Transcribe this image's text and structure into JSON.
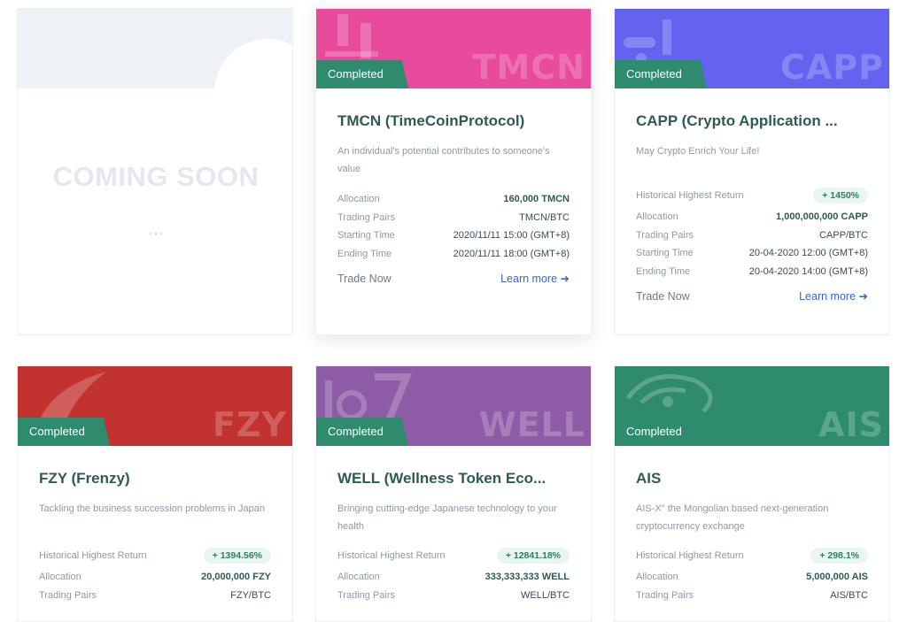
{
  "coming_soon": {
    "text": "COMING SOON",
    "dots": "..."
  },
  "common": {
    "badge": "Completed",
    "trade_label": "Trade Now",
    "learn_label": "Learn more",
    "arrow": "➜",
    "labels": {
      "historical": "Historical Highest Return",
      "allocation": "Allocation",
      "pairs": "Trading Pairs",
      "start": "Starting Time",
      "end": "Ending Time"
    }
  },
  "cards": [
    {
      "ticker": "TMCN",
      "banner_color": "#e84a9c",
      "title": "TMCN (TimeCoinProtocol)",
      "desc": "An individual's potential contributes to someone's value",
      "allocation": "160,000 TMCN",
      "pairs": "TMCN/BTC",
      "start": "2020/11/11 15:00 (GMT+8)",
      "end": "2020/11/11 18:00 (GMT+8)"
    },
    {
      "ticker": "CAPP",
      "banner_color": "#6363f0",
      "title": "CAPP  (Crypto Application ...",
      "desc": "May Crypto Enrich Your Life!",
      "historical": "+ 1450%",
      "allocation": "1,000,000,000 CAPP",
      "pairs": "CAPP/BTC",
      "start": "20-04-2020 12:00 (GMT+8)",
      "end": "20-04-2020 14:00 (GMT+8)"
    },
    {
      "ticker": "FZY",
      "banner_color": "#c2332f",
      "title": "FZY (Frenzy)",
      "desc": "Tackling the business succession problems in Japan",
      "historical": "+ 1394.56%",
      "allocation": "20,000,000 FZY",
      "pairs": "FZY/BTC"
    },
    {
      "ticker": "WELL",
      "banner_color": "#8e5ca6",
      "title": "WELL (Wellness Token Eco...",
      "desc": "Bringing cutting-edge Japanese technology to your health",
      "historical": "+ 12841.18%",
      "allocation": "333,333,333 WELL",
      "pairs": "WELL/BTC"
    },
    {
      "ticker": "AIS",
      "banner_color": "#2e8b6e",
      "title": "AIS",
      "desc": "AIS-X\" the Mongolian based next-generation cryptocurrency exchange",
      "historical": "+ 298.1%",
      "allocation": "5,000,000 AIS",
      "pairs": "AIS/BTC"
    }
  ]
}
